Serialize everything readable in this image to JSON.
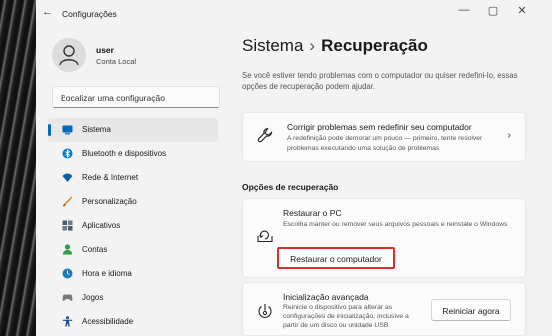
{
  "titlebar": {
    "back_icon": "arrow-left-icon",
    "title": "Configurações",
    "minimize_glyph": "—",
    "maximize_glyph": "▢",
    "close_glyph": "✕"
  },
  "user": {
    "name": "user",
    "account": "Conta Local"
  },
  "search": {
    "placeholder": "Localizar uma configuração",
    "icon": "search-icon"
  },
  "sidebar": {
    "items": [
      {
        "label": "Sistema",
        "icon": "monitor-icon",
        "color": "#0067c0",
        "active": true
      },
      {
        "label": "Bluetooth e dispositivos",
        "icon": "bluetooth-icon",
        "color": "#0078d4"
      },
      {
        "label": "Rede & Internet",
        "icon": "wifi-icon",
        "color": "#0a5ea8"
      },
      {
        "label": "Personalização",
        "icon": "brush-icon",
        "color": "#e07a2c"
      },
      {
        "label": "Aplicativos",
        "icon": "apps-icon",
        "color": "#4a5a6a"
      },
      {
        "label": "Contas",
        "icon": "person-icon",
        "color": "#2ea043"
      },
      {
        "label": "Hora e idioma",
        "icon": "globe-clock-icon",
        "color": "#1f7ab8"
      },
      {
        "label": "Jogos",
        "icon": "gamepad-icon",
        "color": "#7a7a7a"
      },
      {
        "label": "Acessibilidade",
        "icon": "accessibility-icon",
        "color": "#1a4f8a"
      }
    ]
  },
  "main": {
    "breadcrumb_parent": "Sistema",
    "breadcrumb_sep": "›",
    "breadcrumb_current": "Recuperação",
    "intro": "Se você estiver tendo problemas com o computador ou quiser redefini-lo, essas opções de recuperação podem ajudar.",
    "troubleshoot": {
      "title": "Corrigir problemas sem redefinir seu computador",
      "desc": "A redefinição pode demorar um pouco — primeiro, tente resolver problemas executando uma solução de problemas",
      "icon": "wrench-icon",
      "chevron": "›"
    },
    "section_title": "Opções de recuperação",
    "reset": {
      "title": "Restaurar o PC",
      "desc": "Escolha manter ou remover seus arquivos pessoais e reinstale o Windows",
      "icon": "reset-pc-icon",
      "button": "Restaurar o computador",
      "highlight_color": "#d9302b"
    },
    "advanced": {
      "title": "Inicialização avançada",
      "desc": "Reinicie o dispositivo para alterar as configurações de inicialização, inclusive a partir de um disco ou unidade USB",
      "icon": "advanced-startup-icon",
      "button": "Reiniciar agora"
    }
  }
}
